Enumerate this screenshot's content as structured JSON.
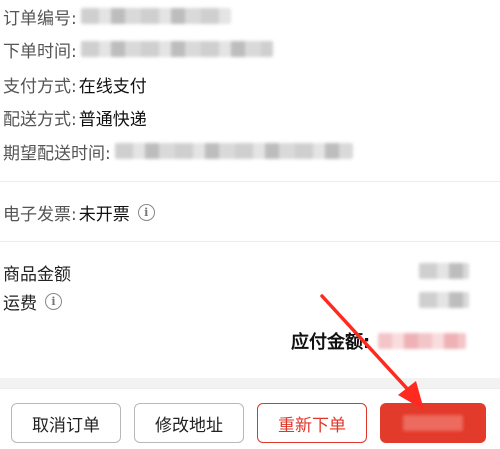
{
  "order_info": {
    "order_no_label": "订单编号:",
    "order_time_label": "下单时间:",
    "payment_label": "支付方式:",
    "payment_value": "在线支付",
    "delivery_label": "配送方式:",
    "delivery_value": "普通快递",
    "expected_time_label": "期望配送时间:"
  },
  "invoice": {
    "label": "电子发票:",
    "value": "未开票",
    "info_icon": "info-icon"
  },
  "amounts": {
    "goods_amount_label": "商品金额",
    "shipping_label": "运费",
    "payable_label": "应付金额:",
    "info_icon": "info-icon"
  },
  "actions": {
    "cancel_label": "取消订单",
    "modify_address_label": "修改地址",
    "reorder_label": "重新下单",
    "accent_color": "#e23a2b"
  },
  "annotation": {
    "arrow_color": "#ff2a1f",
    "arrow_icon": "arrow-annotation"
  }
}
